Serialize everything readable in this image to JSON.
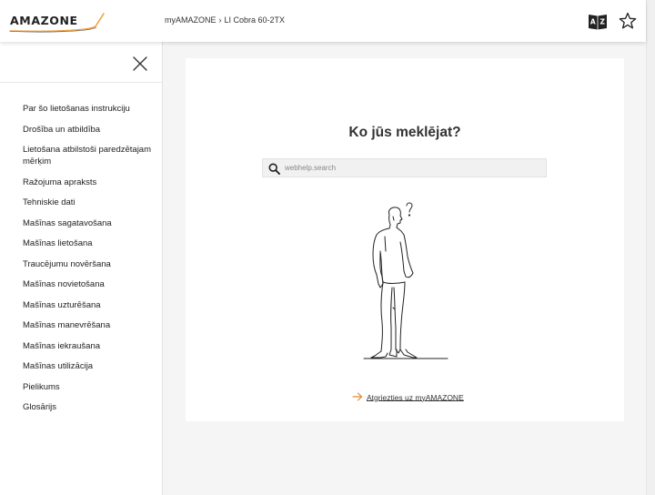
{
  "header": {
    "logo_text": "AMAZONE",
    "breadcrumb": [
      "myAMAZONE",
      "LI Cobra 60-2TX"
    ],
    "icons": {
      "glossary": "glossary-book-icon",
      "favorite": "star-icon"
    }
  },
  "sidebar": {
    "close_icon": "close-icon",
    "items": [
      {
        "label": "Par šo lietošanas instrukciju"
      },
      {
        "label": "Drošība un atbildība"
      },
      {
        "label": "Lietošana atbilstoši paredzētajam mērķim"
      },
      {
        "label": "Ražojuma apraksts"
      },
      {
        "label": "Tehniskie dati"
      },
      {
        "label": "Mašīnas sagatavošana"
      },
      {
        "label": "Mašīnas lietošana"
      },
      {
        "label": "Traucējumu novēršana"
      },
      {
        "label": "Mašīnas novietošana"
      },
      {
        "label": "Mašīnas uzturēšana"
      },
      {
        "label": "Mašīnas manevrēšana"
      },
      {
        "label": "Mašīnas iekraušana"
      },
      {
        "label": "Mašīnas utilizācija"
      },
      {
        "label": "Pielikums"
      },
      {
        "label": "Glosārijs"
      }
    ]
  },
  "main": {
    "title": "Ko jūs meklējat?",
    "search": {
      "placeholder": "webhelp.search",
      "value": "",
      "icon": "search-icon"
    },
    "illustration": "person-thinking-question-mark",
    "back_link": "Atgriezties uz myAMAZONE",
    "colors": {
      "accent": "#e8882a",
      "brand_swoosh": "#f0a040"
    }
  }
}
